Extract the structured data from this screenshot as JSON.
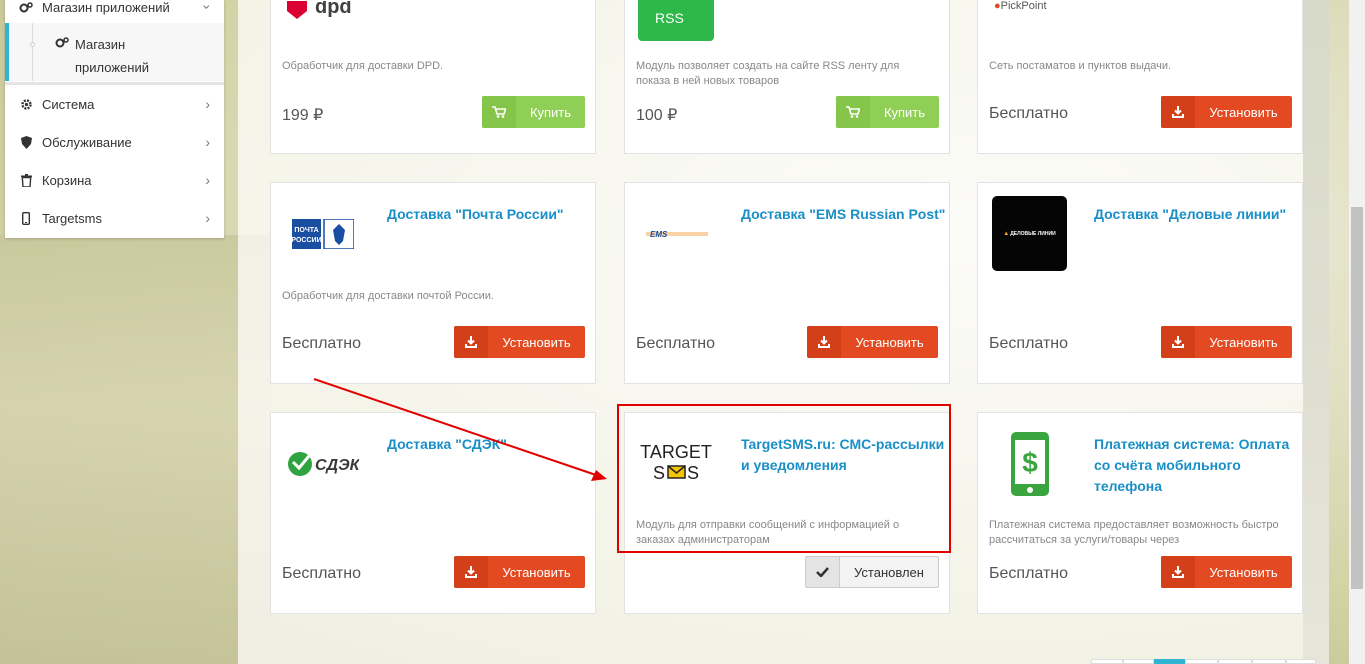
{
  "sidebar": {
    "top_item": "Магазин приложений",
    "sub_item": "Магазин приложений",
    "items": [
      {
        "label": "Система",
        "icon": "gear-icon"
      },
      {
        "label": "Обслуживание",
        "icon": "shield-icon"
      },
      {
        "label": "Корзина",
        "icon": "trash-icon"
      },
      {
        "label": "Targetsms",
        "icon": "mobile-icon"
      }
    ]
  },
  "cards": [
    {
      "title": "",
      "logo": "dpd",
      "description": "Обработчик для доставки DPD.",
      "price": "199 ₽",
      "action": "Купить",
      "action_type": "buy"
    },
    {
      "title": "",
      "logo": "RSS",
      "description": "Модуль позволяет создать на сайте RSS ленту для показа в ней новых товаров",
      "price": "100 ₽",
      "action": "Купить",
      "action_type": "buy"
    },
    {
      "title": "",
      "logo": "PickPoint",
      "description": "Сеть постаматов и пунктов выдачи.",
      "price": "Бесплатно",
      "action": "Установить",
      "action_type": "install"
    },
    {
      "title": "Доставка \"Почта России\"",
      "logo": "ПОЧТА РОССИИ",
      "description": "Обработчик для доставки почтой России.",
      "price": "Бесплатно",
      "action": "Установить",
      "action_type": "install"
    },
    {
      "title": "Доставка \"EMS Russian Post\"",
      "logo": "EMS",
      "description": "",
      "price": "Бесплатно",
      "action": "Установить",
      "action_type": "install"
    },
    {
      "title": "Доставка \"Деловые линии\"",
      "logo": "ДЕЛОВЫЕ ЛИНИИ",
      "description": "",
      "price": "Бесплатно",
      "action": "Установить",
      "action_type": "install"
    },
    {
      "title": "Доставка \"СДЭК\"",
      "logo": "СДЭК",
      "description": "",
      "price": "Бесплатно",
      "action": "Установить",
      "action_type": "install"
    },
    {
      "title": "TargetSMS.ru: СМС-рассылки и уведомления",
      "logo": "TARGET SMS",
      "description": "Модуль для отправки сообщений с информацией о заказах администраторам",
      "price": "",
      "action": "Установлен",
      "action_type": "installed"
    },
    {
      "title": "Платежная система: Оплата со счёта мобильного телефона",
      "logo": "$",
      "description": "Платежная система предоставляет возможность быстро рассчитаться за услуги/товары через",
      "price": "Бесплатно",
      "action": "Установить",
      "action_type": "install"
    }
  ],
  "colors": {
    "accent": "#1a8fc7",
    "install": "#e34a22",
    "buy": "#8fcf55",
    "highlight": "#e10000"
  }
}
